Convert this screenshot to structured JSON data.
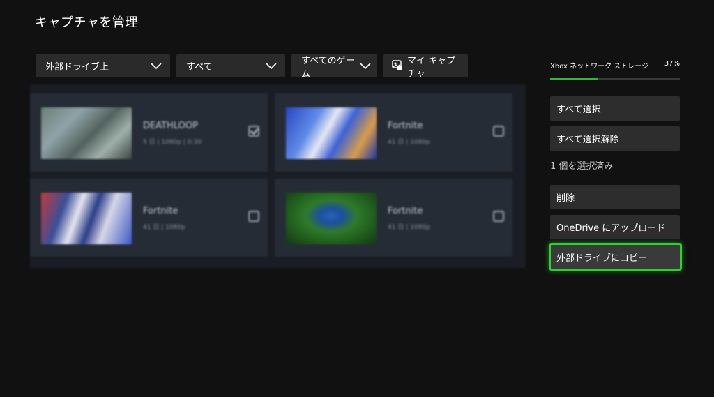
{
  "page": {
    "title": "キャプチャを管理"
  },
  "filters": {
    "location": "外部ドライブ上",
    "type": "すべて",
    "game": "すべてのゲーム",
    "my_captures": "マイ キャプチャ"
  },
  "captures": [
    {
      "title": "DEATHLOOP",
      "meta": "5 日 | 1080p | 0:30",
      "checked": true
    },
    {
      "title": "Fortnite",
      "meta": "41 日 | 1080p",
      "checked": false
    },
    {
      "title": "Fortnite",
      "meta": "41 日 | 1080p",
      "checked": false
    },
    {
      "title": "Fortnite",
      "meta": "41 日 | 1080p",
      "checked": false
    }
  ],
  "storage": {
    "label": "Xbox ネットワーク ストレージ",
    "percent_text": "37%",
    "percent": 37,
    "fill_color": "#33b540"
  },
  "actions": {
    "select_all": "すべて選択",
    "deselect_all": "すべて選択解除",
    "selected_count": "1 個を選択済み",
    "delete": "削除",
    "upload_onedrive": "OneDrive にアップロード",
    "copy_external": "外部ドライブにコピー"
  },
  "accent_color": "#2fd12f"
}
